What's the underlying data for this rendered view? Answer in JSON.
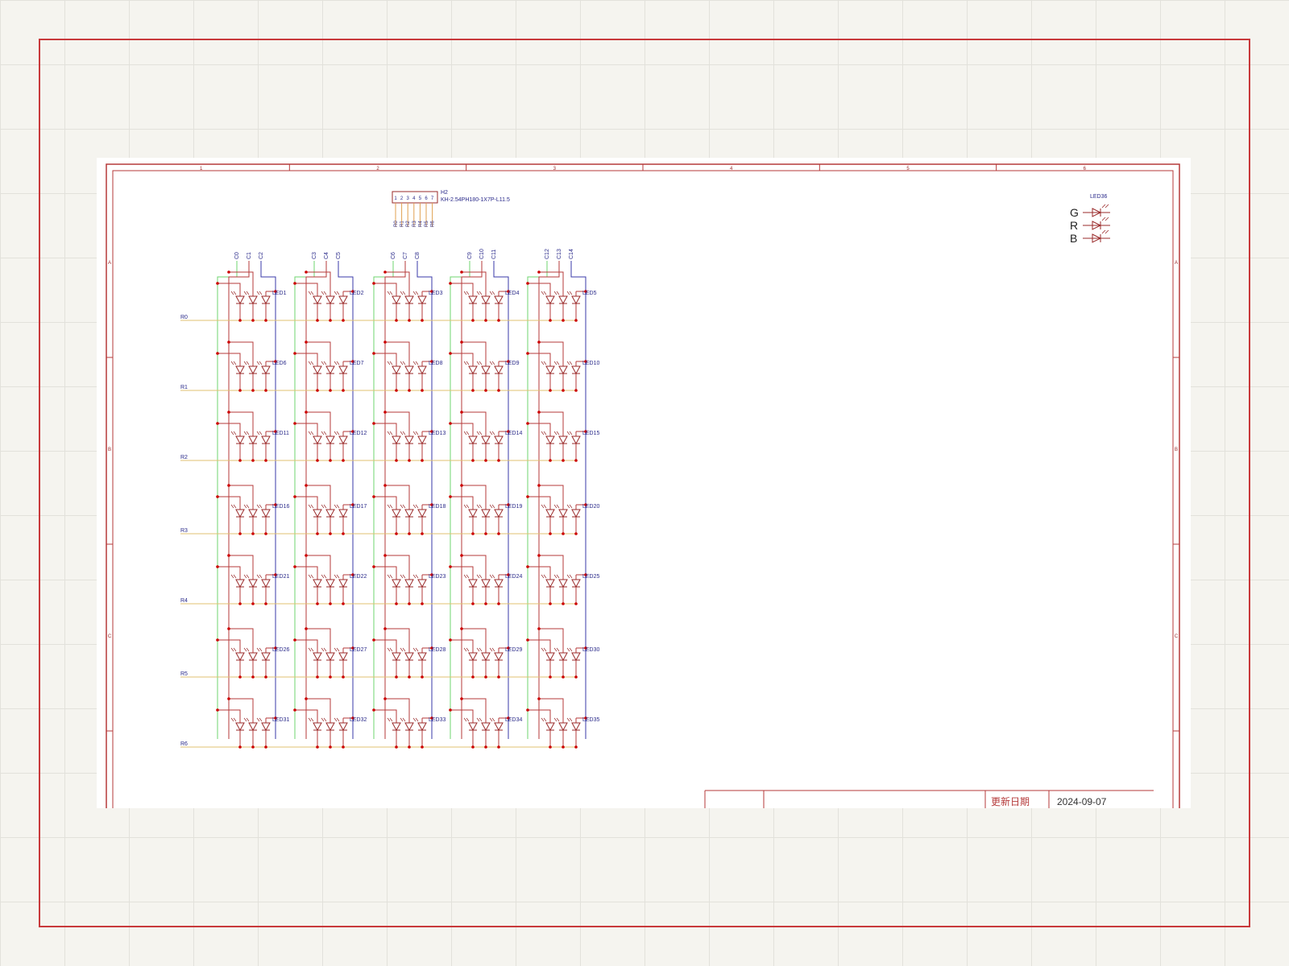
{
  "sheet": {
    "column_markers": [
      "1",
      "2",
      "3",
      "4",
      "5",
      "6"
    ],
    "row_markers": [
      "A",
      "B",
      "C"
    ],
    "title_block": {
      "date_label": "更新日期",
      "date_value": "2024-09-07"
    }
  },
  "connector": {
    "designator": "H2",
    "part": "KH-2.54PH180-1X7P-L11.5",
    "pins": [
      "1",
      "2",
      "3",
      "4",
      "5",
      "6",
      "7"
    ],
    "nets": [
      "R0",
      "R1",
      "R2",
      "R3",
      "R4",
      "R5",
      "R6"
    ]
  },
  "legend": {
    "designator": "LED36",
    "colors": [
      "G",
      "R",
      "B"
    ]
  },
  "matrix": {
    "column_groups": [
      [
        "C0",
        "C1",
        "C2"
      ],
      [
        "C3",
        "C4",
        "C5"
      ],
      [
        "C6",
        "C7",
        "C8"
      ],
      [
        "C9",
        "C10",
        "C11"
      ],
      [
        "C12",
        "C13",
        "C14"
      ]
    ],
    "row_labels": [
      "R0",
      "R1",
      "R2",
      "R3",
      "R4",
      "R5",
      "R6"
    ],
    "led_labels": [
      [
        "LED1",
        "LED2",
        "LED3",
        "LED4",
        "LED5"
      ],
      [
        "LED6",
        "LED7",
        "LED8",
        "LED9",
        "LED10"
      ],
      [
        "LED11",
        "LED12",
        "LED13",
        "LED14",
        "LED15"
      ],
      [
        "LED16",
        "LED17",
        "LED18",
        "LED19",
        "LED20"
      ],
      [
        "LED21",
        "LED22",
        "LED23",
        "LED24",
        "LED25"
      ],
      [
        "LED26",
        "LED27",
        "LED28",
        "LED29",
        "LED30"
      ],
      [
        "LED31",
        "LED32",
        "LED33",
        "LED34",
        "LED35"
      ]
    ]
  },
  "colors": {
    "green_net": "#6fd46f",
    "red_net": "#b53a3a",
    "blue_net": "#3a3aa8",
    "row_net": "#e0c070",
    "label": "#2a2a8a",
    "component": "#9a2a2a",
    "junction": "#cc0000"
  }
}
